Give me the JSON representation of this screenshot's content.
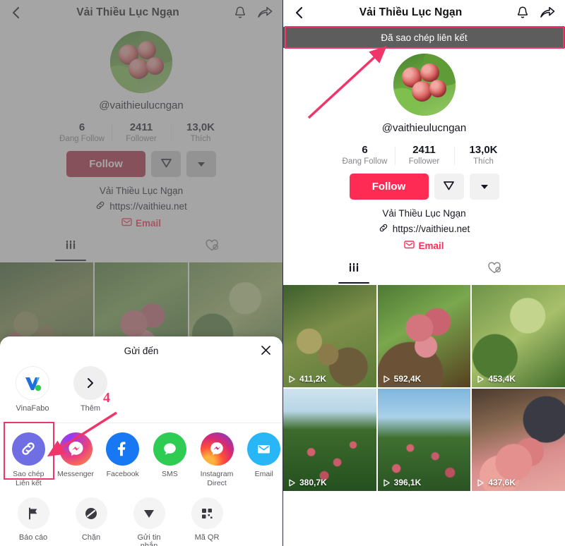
{
  "header": {
    "title": "Vải Thiều Lục Ngạn",
    "back_icon": "chevron-left-icon",
    "bell_icon": "bell-icon",
    "share_icon": "share-arrow-icon"
  },
  "toast": {
    "message": "Đã sao chép liên kết"
  },
  "profile": {
    "handle": "@vaithieulucngan",
    "bio_name": "Vải Thiều Lục Ngạn",
    "bio_link": "https://vaithieu.net",
    "bio_link_icon": "link-icon",
    "email_label": "Email",
    "email_icon": "mail-icon",
    "avatar_alt": "lychee-fruit-avatar",
    "stats": [
      {
        "num": "6",
        "label": "Đang Follow"
      },
      {
        "num": "2411",
        "label": "Follower"
      },
      {
        "num": "13,0K",
        "label": "Thích"
      }
    ],
    "follow_label": "Follow",
    "follow_color": "#fe2c55",
    "follow_color_dim": "#b02440",
    "message_icon": "paper-plane-icon",
    "more_icon": "chevron-down-icon",
    "tabs": [
      {
        "name": "videos",
        "icon": "grid-bars-icon",
        "active": true
      },
      {
        "name": "liked",
        "icon": "heart-slash-icon",
        "active": false
      }
    ]
  },
  "videos": [
    {
      "views": "411,2K",
      "thumb": "lychee-unripe-branch"
    },
    {
      "views": "592,4K",
      "thumb": "lychee-cluster-closeup"
    },
    {
      "views": "453,4K",
      "thumb": "lychee-tree-leaves"
    },
    {
      "views": "380,7K",
      "thumb": "lychee-orchard-sky"
    },
    {
      "views": "396,1K",
      "thumb": "lychee-bush-blue-sky"
    },
    {
      "views": "437,6K",
      "thumb": "lychee-bouquet-market"
    }
  ],
  "share_sheet": {
    "title": "Gửi đến",
    "close_icon": "close-icon",
    "apps": [
      {
        "label": "VinaFabo",
        "icon": "vinafabo-logo-icon"
      },
      {
        "label": "Thêm",
        "icon": "chevron-right-icon"
      }
    ],
    "targets": [
      {
        "label": "Sao chép\nLiên kết",
        "label_line1": "Sao chép",
        "label_line2": "Liên kết",
        "icon": "copy-link-icon",
        "color": "#6f6fe3",
        "highlighted": true
      },
      {
        "label_line1": "Messenger",
        "label_line2": "",
        "icon": "messenger-icon",
        "color": "#a033ff"
      },
      {
        "label_line1": "Facebook",
        "label_line2": "",
        "icon": "facebook-icon",
        "color": "#1877f2"
      },
      {
        "label_line1": "SMS",
        "label_line2": "",
        "icon": "sms-icon",
        "color": "#2ecc52"
      },
      {
        "label_line1": "Instagram",
        "label_line2": "Direct",
        "icon": "instagram-direct-icon",
        "color": "#e1306c"
      },
      {
        "label_line1": "Email",
        "label_line2": "",
        "icon": "email-icon",
        "color": "#29b6f6"
      }
    ],
    "tools": [
      {
        "label": "Báo cáo",
        "icon": "flag-icon"
      },
      {
        "label": "Chặn",
        "icon": "block-icon"
      },
      {
        "label": "Gửi tin nhắn",
        "icon": "paper-plane-icon"
      },
      {
        "label": "Mã QR",
        "icon": "qr-code-icon"
      }
    ]
  },
  "annotations": {
    "step_marker": "4",
    "accent_color": "#f0356b"
  }
}
